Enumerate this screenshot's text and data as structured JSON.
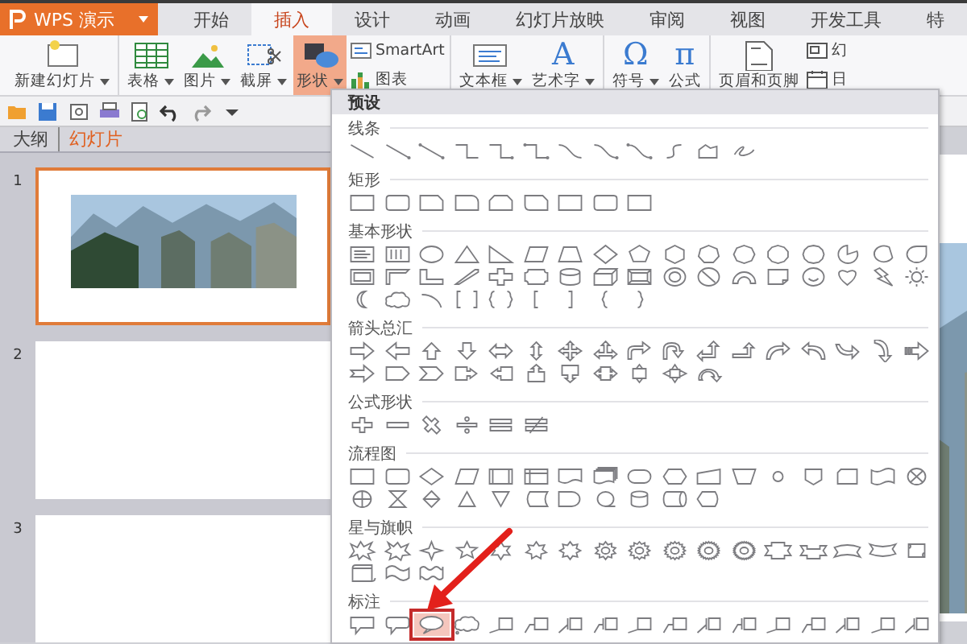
{
  "app_menu": {
    "label": "WPS 演示",
    "has_menu": true
  },
  "tabs": [
    {
      "label": "开始",
      "selected": false
    },
    {
      "label": "插入",
      "selected": true
    },
    {
      "label": "设计",
      "selected": false
    },
    {
      "label": "动画",
      "selected": false
    },
    {
      "label": "幻灯片放映",
      "selected": false
    },
    {
      "label": "审阅",
      "selected": false
    },
    {
      "label": "视图",
      "selected": false
    },
    {
      "label": "开发工具",
      "selected": false
    },
    {
      "label": "特",
      "selected": false
    }
  ],
  "ribbon": {
    "groups": [
      {
        "items": [
          {
            "kind": "large",
            "label": "新建幻灯片",
            "has_menu": true,
            "active": false
          }
        ]
      },
      {
        "items": [
          {
            "kind": "large",
            "label": "表格",
            "has_menu": true,
            "active": false
          },
          {
            "kind": "large",
            "label": "图片",
            "has_menu": true,
            "active": false
          },
          {
            "kind": "large",
            "label": "截屏",
            "has_menu": true,
            "active": false
          },
          {
            "kind": "large",
            "label": "形状",
            "has_menu": true,
            "active": true
          },
          {
            "kind": "stack",
            "buttons": [
              {
                "label": "SmartArt"
              },
              {
                "label": "图表"
              }
            ]
          }
        ]
      },
      {
        "items": [
          {
            "kind": "large",
            "label": "文本框",
            "has_menu": true,
            "active": false
          },
          {
            "kind": "large",
            "label": "艺术字",
            "has_menu": true,
            "active": false,
            "icon_text": "A"
          }
        ]
      },
      {
        "items": [
          {
            "kind": "large",
            "label": "符号",
            "has_menu": true,
            "active": false,
            "icon_text": "Ω"
          },
          {
            "kind": "large",
            "label": "公式",
            "has_menu": false,
            "active": false,
            "icon_text": "π"
          }
        ]
      },
      {
        "items": [
          {
            "kind": "large",
            "label": "页眉和页脚",
            "has_menu": false,
            "active": false
          },
          {
            "kind": "stack",
            "buttons": [
              {
                "label": "幻"
              },
              {
                "label": "日"
              }
            ]
          }
        ]
      }
    ]
  },
  "pane": {
    "tabs": [
      {
        "label": "大纲",
        "selected": false
      },
      {
        "label": "幻灯片",
        "selected": true
      }
    ],
    "slides": [
      {
        "number": "1",
        "selected": true,
        "kind": "picture"
      },
      {
        "number": "2",
        "selected": false,
        "kind": "blank"
      },
      {
        "number": "3",
        "selected": false,
        "kind": "blank"
      }
    ]
  },
  "gallery": {
    "header": "预设",
    "sections": [
      {
        "title": "线条",
        "shapes": [
          {
            "kind": "line"
          },
          {
            "kind": "arrow-line"
          },
          {
            "kind": "dot-line"
          },
          {
            "kind": "elbow"
          },
          {
            "kind": "elbow-arrow"
          },
          {
            "kind": "elbow-dots"
          },
          {
            "kind": "curve"
          },
          {
            "kind": "curve-arrow"
          },
          {
            "kind": "curve-dots"
          },
          {
            "kind": "freeform"
          },
          {
            "kind": "polygon-outline"
          },
          {
            "kind": "scribble"
          }
        ]
      },
      {
        "title": "矩形",
        "shapes": [
          {
            "kind": "rectangle"
          },
          {
            "kind": "rounded-rectangle"
          },
          {
            "kind": "snipped-rectangle"
          },
          {
            "kind": "round-corner-rectangle"
          },
          {
            "kind": "double-snipped-rectangle"
          },
          {
            "kind": "snip-round-rectangle"
          },
          {
            "kind": "rectangle"
          },
          {
            "kind": "rounded-rectangle"
          },
          {
            "kind": "rectangle"
          }
        ]
      },
      {
        "title": "基本形状",
        "shapes": [
          {
            "kind": "text-box"
          },
          {
            "kind": "vertical-text-box"
          },
          {
            "kind": "ellipse"
          },
          {
            "kind": "triangle"
          },
          {
            "kind": "right-triangle"
          },
          {
            "kind": "parallelogram"
          },
          {
            "kind": "trapezoid"
          },
          {
            "kind": "diamond"
          },
          {
            "kind": "pentagon"
          },
          {
            "kind": "hexagon"
          },
          {
            "kind": "heptagon"
          },
          {
            "kind": "octagon"
          },
          {
            "kind": "decagon"
          },
          {
            "kind": "dodecagon"
          },
          {
            "kind": "pie"
          },
          {
            "kind": "chord"
          },
          {
            "kind": "teardrop"
          },
          {
            "kind": "frame"
          },
          {
            "kind": "half-frame"
          },
          {
            "kind": "l-shape"
          },
          {
            "kind": "diagonal-stripe"
          },
          {
            "kind": "cross"
          },
          {
            "kind": "plaque"
          },
          {
            "kind": "can"
          },
          {
            "kind": "cube"
          },
          {
            "kind": "bevel"
          },
          {
            "kind": "donut"
          },
          {
            "kind": "no-symbol"
          },
          {
            "kind": "block-arc"
          },
          {
            "kind": "folded-corner"
          },
          {
            "kind": "smiley"
          },
          {
            "kind": "heart"
          },
          {
            "kind": "lightning"
          },
          {
            "kind": "sun"
          },
          {
            "kind": "moon"
          },
          {
            "kind": "cloud"
          },
          {
            "kind": "arc"
          },
          {
            "kind": "bracket-pair"
          },
          {
            "kind": "brace-pair"
          },
          {
            "kind": "left-bracket"
          },
          {
            "kind": "right-bracket"
          },
          {
            "kind": "left-brace"
          },
          {
            "kind": "right-brace"
          }
        ]
      },
      {
        "title": "箭头总汇",
        "shapes": [
          {
            "kind": "right-arrow"
          },
          {
            "kind": "left-arrow"
          },
          {
            "kind": "up-arrow"
          },
          {
            "kind": "down-arrow"
          },
          {
            "kind": "left-right-arrow"
          },
          {
            "kind": "up-down-arrow"
          },
          {
            "kind": "quad-arrow"
          },
          {
            "kind": "left-right-up-arrow"
          },
          {
            "kind": "bent-arrow"
          },
          {
            "kind": "u-turn-arrow"
          },
          {
            "kind": "left-up-arrow"
          },
          {
            "kind": "bent-up-arrow"
          },
          {
            "kind": "curved-right-arrow"
          },
          {
            "kind": "curved-left-arrow"
          },
          {
            "kind": "curved-up-arrow"
          },
          {
            "kind": "curved-down-arrow"
          },
          {
            "kind": "striped-right-arrow"
          },
          {
            "kind": "notched-right-arrow"
          },
          {
            "kind": "pentagon-arrow"
          },
          {
            "kind": "chevron"
          },
          {
            "kind": "right-arrow-callout"
          },
          {
            "kind": "left-arrow-callout"
          },
          {
            "kind": "up-arrow-callout"
          },
          {
            "kind": "down-arrow-callout"
          },
          {
            "kind": "left-right-arrow-callout"
          },
          {
            "kind": "up-down-arrow-callout"
          },
          {
            "kind": "quad-arrow-callout"
          },
          {
            "kind": "circular-arrow"
          }
        ]
      },
      {
        "title": "公式形状",
        "shapes": [
          {
            "kind": "plus"
          },
          {
            "kind": "minus"
          },
          {
            "kind": "multiply"
          },
          {
            "kind": "divide"
          },
          {
            "kind": "equal"
          },
          {
            "kind": "not-equal"
          }
        ]
      },
      {
        "title": "流程图",
        "shapes": [
          {
            "kind": "process"
          },
          {
            "kind": "alternate-process"
          },
          {
            "kind": "decision"
          },
          {
            "kind": "data"
          },
          {
            "kind": "predefined-process"
          },
          {
            "kind": "internal-storage"
          },
          {
            "kind": "document"
          },
          {
            "kind": "multidocument"
          },
          {
            "kind": "terminator"
          },
          {
            "kind": "preparation"
          },
          {
            "kind": "manual-input"
          },
          {
            "kind": "manual-operation"
          },
          {
            "kind": "connector"
          },
          {
            "kind": "off-page-connector"
          },
          {
            "kind": "card"
          },
          {
            "kind": "punched-tape"
          },
          {
            "kind": "summing-junction"
          },
          {
            "kind": "or"
          },
          {
            "kind": "collate"
          },
          {
            "kind": "sort"
          },
          {
            "kind": "extract"
          },
          {
            "kind": "merge"
          },
          {
            "kind": "stored-data"
          },
          {
            "kind": "delay"
          },
          {
            "kind": "sequential-storage"
          },
          {
            "kind": "magnetic-disk"
          },
          {
            "kind": "direct-access-storage"
          },
          {
            "kind": "display"
          }
        ]
      },
      {
        "title": "星与旗帜",
        "shapes": [
          {
            "kind": "explosion"
          },
          {
            "kind": "explosion-two"
          },
          {
            "kind": "four-point-star"
          },
          {
            "kind": "five-point-star"
          },
          {
            "kind": "six-point-star"
          },
          {
            "kind": "seven-point-star"
          },
          {
            "kind": "eight-point-star"
          },
          {
            "kind": "ten-point-star"
          },
          {
            "kind": "twelve-point-star"
          },
          {
            "kind": "sixteen-point-star"
          },
          {
            "kind": "twenty-four-point-star"
          },
          {
            "kind": "thirty-two-point-star"
          },
          {
            "kind": "up-ribbon"
          },
          {
            "kind": "down-ribbon"
          },
          {
            "kind": "curved-up-ribbon"
          },
          {
            "kind": "curved-down-ribbon"
          },
          {
            "kind": "vertical-scroll"
          },
          {
            "kind": "horizontal-scroll"
          },
          {
            "kind": "wave"
          },
          {
            "kind": "double-wave"
          }
        ]
      },
      {
        "title": "标注",
        "shapes": [
          {
            "kind": "rectangular-callout",
            "selected": false
          },
          {
            "kind": "rounded-callout",
            "selected": false
          },
          {
            "kind": "oval-callout",
            "selected": true
          },
          {
            "kind": "cloud-callout",
            "selected": false
          },
          {
            "kind": "line-callout",
            "selected": false
          },
          {
            "kind": "bent-line-callout",
            "selected": false
          },
          {
            "kind": "accent-callout",
            "selected": false
          },
          {
            "kind": "accent-bent-callout",
            "selected": false
          },
          {
            "kind": "border-callout",
            "selected": false
          },
          {
            "kind": "border-bent-callout",
            "selected": false
          },
          {
            "kind": "accent-border-callout",
            "selected": false
          },
          {
            "kind": "accent-border-bent-callout",
            "selected": false
          },
          {
            "kind": "line-callout",
            "selected": false
          },
          {
            "kind": "bent-line-callout",
            "selected": false
          },
          {
            "kind": "accent-callout",
            "selected": false
          },
          {
            "kind": "border-callout",
            "selected": false
          },
          {
            "kind": "accent-border-callout",
            "selected": false
          }
        ]
      }
    ]
  }
}
